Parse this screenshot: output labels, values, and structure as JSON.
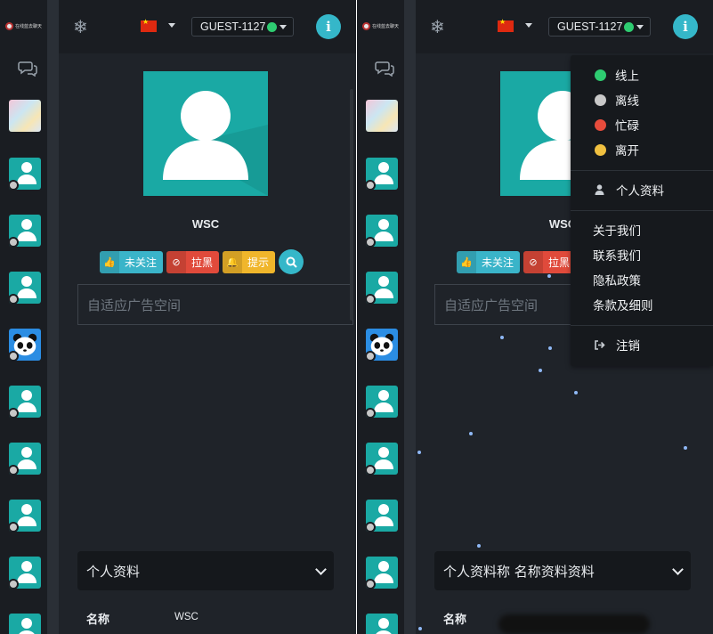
{
  "app": {
    "logo_text": "在线蓝去聊天",
    "username": "GUEST-1127",
    "status_color": "#2ecc71",
    "accent_color": "#35b7c9"
  },
  "profile": {
    "name": "WSC",
    "avatar_color": "#1aa9a4",
    "buttons": {
      "follow": "未关注",
      "block": "拉黑",
      "notify": "提示"
    },
    "ad_placeholder": "自适应广告空间",
    "section_title": "个人资料",
    "fields": [
      {
        "label": "名称",
        "value": "WSC"
      }
    ]
  },
  "right_overlay_text": "个人资料称 名称资料资料",
  "dropdown": {
    "statuses": [
      {
        "label": "线上",
        "color": "#2ecc71"
      },
      {
        "label": "离线",
        "color": "#c8c8c8"
      },
      {
        "label": "忙碌",
        "color": "#e74c3c"
      },
      {
        "label": "离开",
        "color": "#f0c040"
      }
    ],
    "profile_label": "个人资料",
    "links": [
      "关于我们",
      "联系我们",
      "隐私政策",
      "条款及细则"
    ],
    "logout_label": "注销"
  },
  "icons": {
    "snowflake": "snowflake-icon",
    "flag": "china-flag-icon",
    "info": "info-icon",
    "chat": "chat-bubbles-icon",
    "search": "search-icon",
    "thumbs_up": "thumbs-up-icon",
    "ban": "ban-icon",
    "bell": "bell-icon",
    "user": "user-icon",
    "logout": "sign-out-icon"
  }
}
